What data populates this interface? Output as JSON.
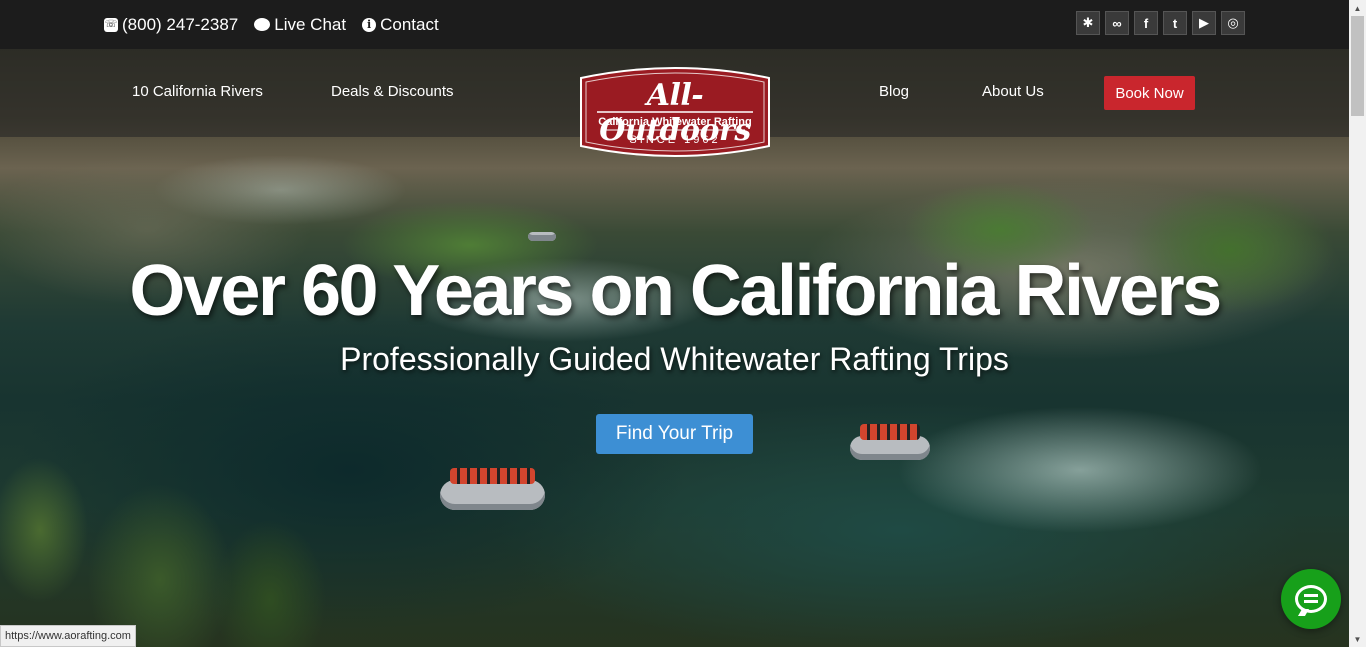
{
  "topbar": {
    "phone": "(800) 247-2387",
    "live_chat": "Live Chat",
    "contact": "Contact",
    "social": [
      {
        "name": "yelp-icon",
        "glyph": "✱"
      },
      {
        "name": "tripadvisor-icon",
        "glyph": "∞"
      },
      {
        "name": "facebook-icon",
        "glyph": "f"
      },
      {
        "name": "twitter-icon",
        "glyph": "t"
      },
      {
        "name": "youtube-icon",
        "glyph": "▶"
      },
      {
        "name": "instagram-icon",
        "glyph": "◎"
      }
    ]
  },
  "nav": {
    "rivers": "10 California Rivers",
    "deals": "Deals & Discounts",
    "blog": "Blog",
    "about": "About Us",
    "book": "Book Now"
  },
  "logo": {
    "main": "All-Outdoors",
    "sub": "California Whitewater Rafting",
    "since": "SINCE 1962"
  },
  "hero": {
    "headline": "Over 60 Years on California Rivers",
    "subhead": "Professionally Guided Whitewater Rafting Trips",
    "cta": "Find Your Trip"
  },
  "status_url": "https://www.aorafting.com",
  "colors": {
    "accent_red": "#c9262d",
    "cta_blue": "#3d8fd4",
    "chat_green": "#17a01a",
    "topbar": "#1c1c1c"
  }
}
